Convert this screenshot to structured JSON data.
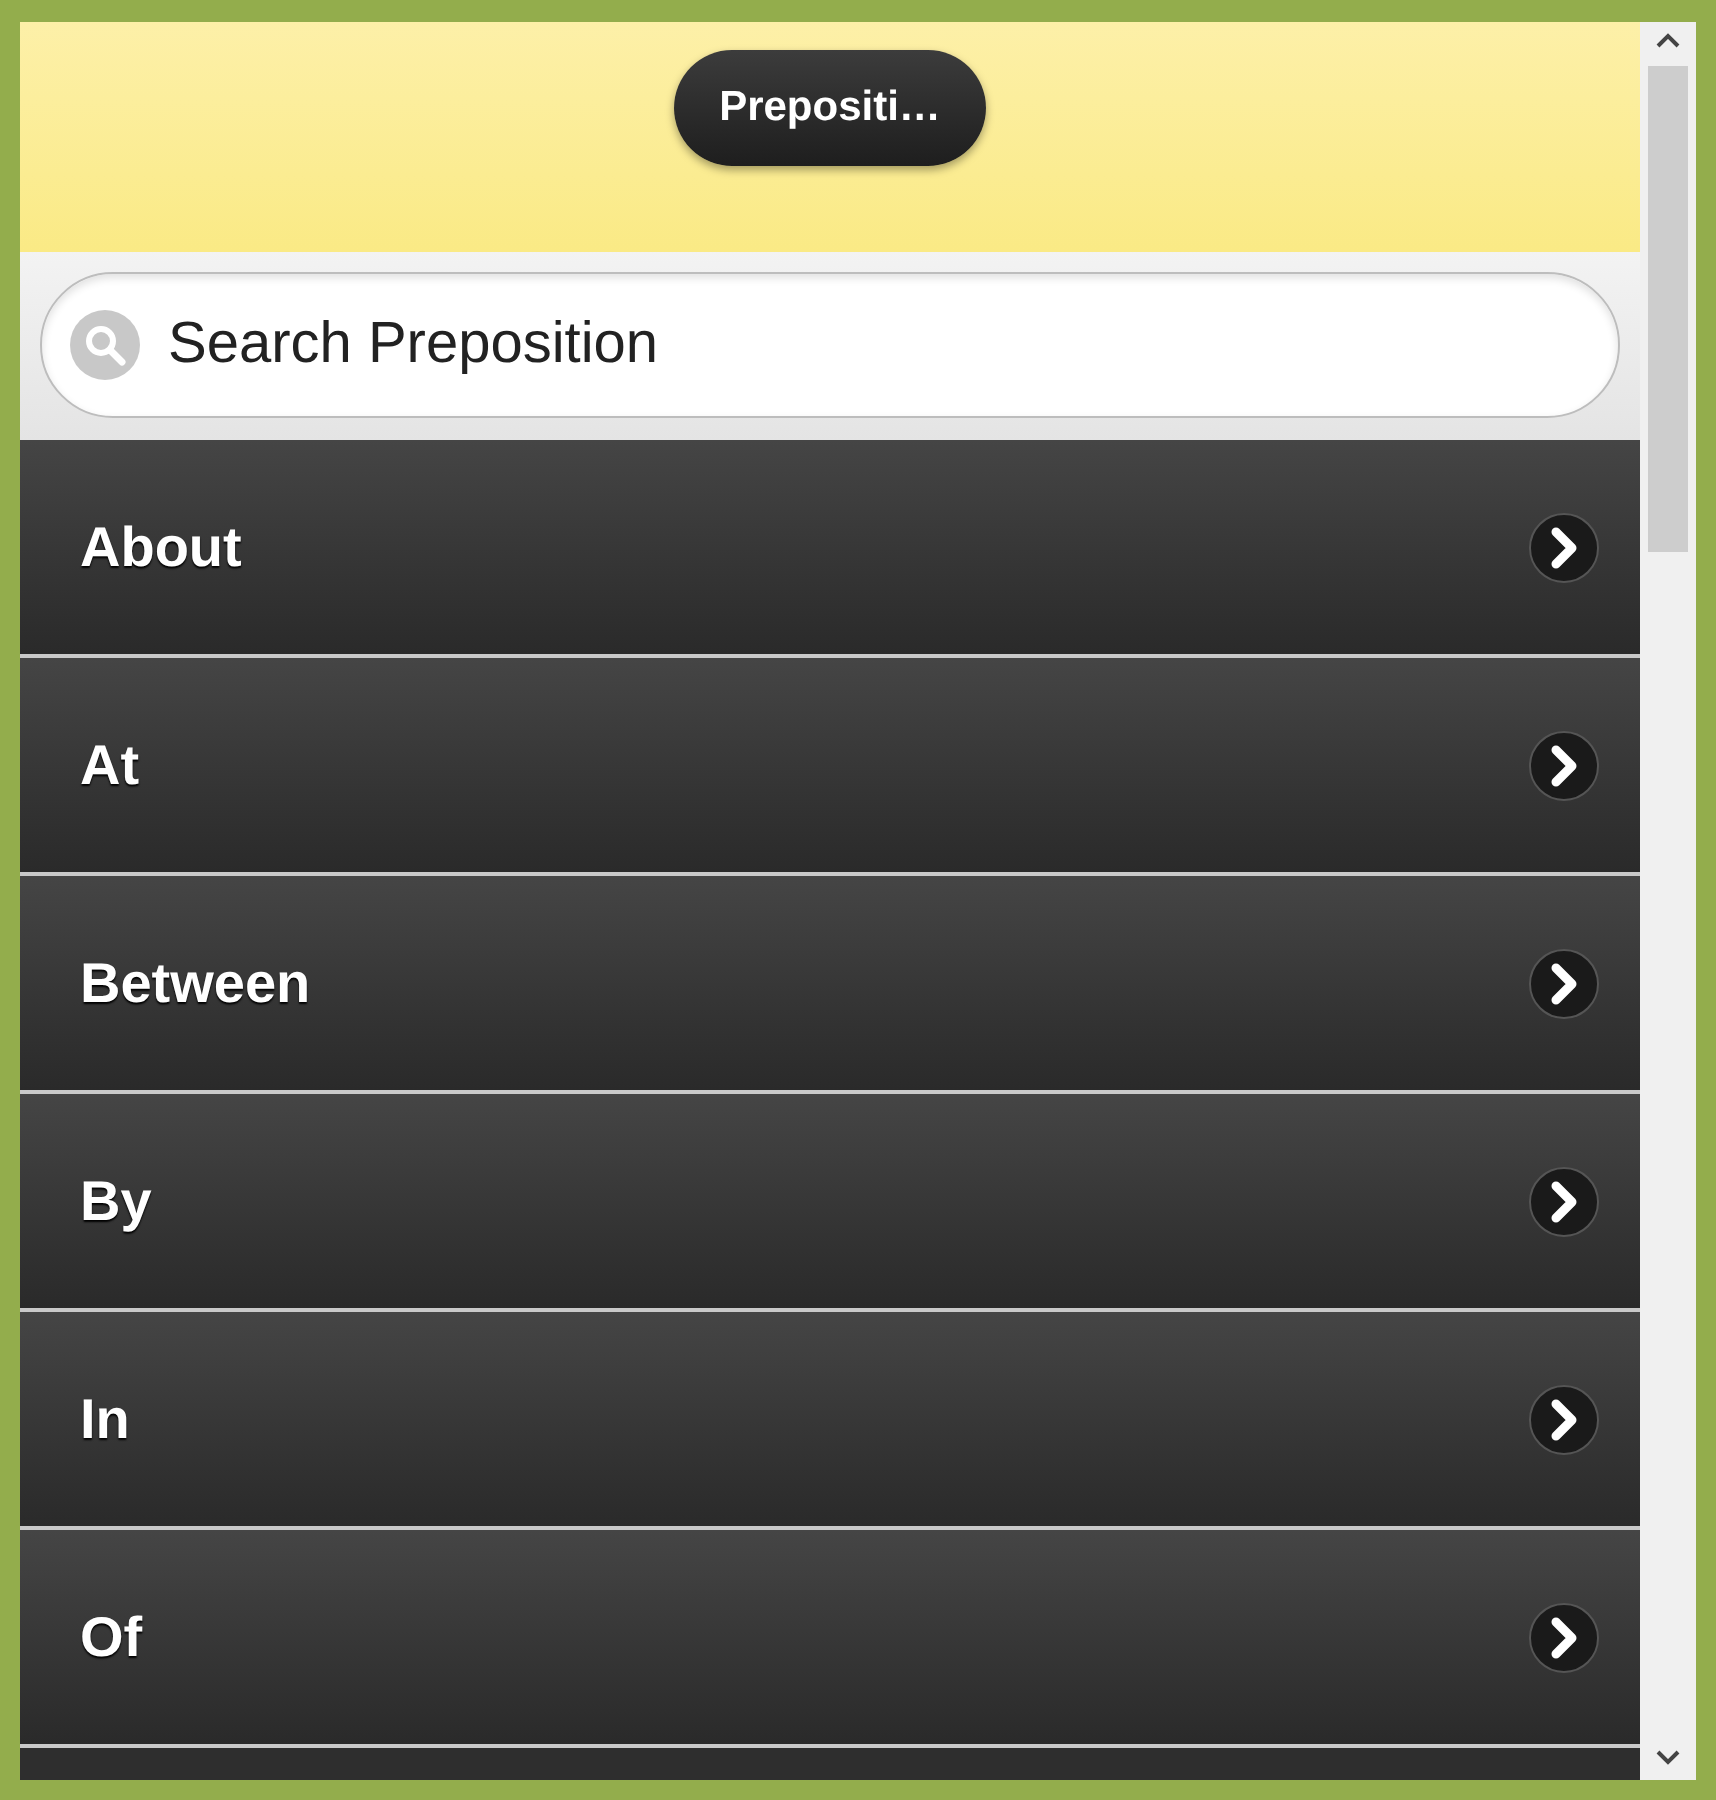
{
  "header": {
    "title": "Prepositi…"
  },
  "search": {
    "placeholder": "Search Preposition"
  },
  "list": {
    "items": [
      {
        "label": "About"
      },
      {
        "label": "At"
      },
      {
        "label": "Between"
      },
      {
        "label": "By"
      },
      {
        "label": "In"
      },
      {
        "label": "Of"
      }
    ]
  }
}
